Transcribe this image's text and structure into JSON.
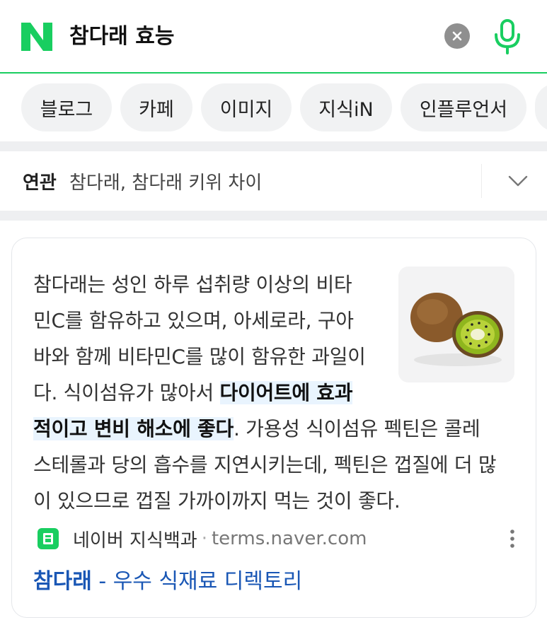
{
  "search": {
    "logo_letter": "N",
    "query": "참다래 효능",
    "clear_icon": "close-icon",
    "mic_icon": "microphone-icon"
  },
  "tabs": [
    {
      "label": "블로그"
    },
    {
      "label": "카페"
    },
    {
      "label": "이미지"
    },
    {
      "label": "지식iN"
    },
    {
      "label": "인플루언서"
    }
  ],
  "related": {
    "label": "연관",
    "text": "참다래, 참다래 키위 차이",
    "expand_icon": "chevron-down-icon"
  },
  "result": {
    "lines": [
      {
        "before": "참다래는 성인 하루 섭취량 이상의 비타",
        "highlight": "",
        "after": ""
      },
      {
        "before": "민C를 함유하고 있으며, 아세로라, 구아",
        "highlight": "",
        "after": ""
      },
      {
        "before": "바와 함께 비타민C를 많이 함유한 과일이",
        "highlight": "",
        "after": ""
      },
      {
        "before": "다. 식이섬유가 많아서 ",
        "highlight": "다이어트에 효과",
        "after": ""
      },
      {
        "before": "",
        "highlight": "적이고 변비 해소에 좋다",
        "after": ". 가용성 식이섬유 펙틴은 콜레"
      },
      {
        "before": "스테롤과 당의 흡수를 지연시키는데, 펙틴은 껍질에 더 많",
        "highlight": "",
        "after": ""
      },
      {
        "before": "이 있으므로 껍질 가까이까지 먹는 것이 좋다.",
        "highlight": "",
        "after": ""
      }
    ],
    "image_alt": "kiwi",
    "source_name": "네이버 지식백과",
    "source_dot": "·",
    "source_domain": "terms.naver.com",
    "title_strong": "참다래",
    "title_rest": " - 우수 식재료 디렉토리",
    "colors": {
      "brand": "#19ce60",
      "link": "#1a57b5",
      "highlight_bg": "#e9f4fe"
    }
  }
}
